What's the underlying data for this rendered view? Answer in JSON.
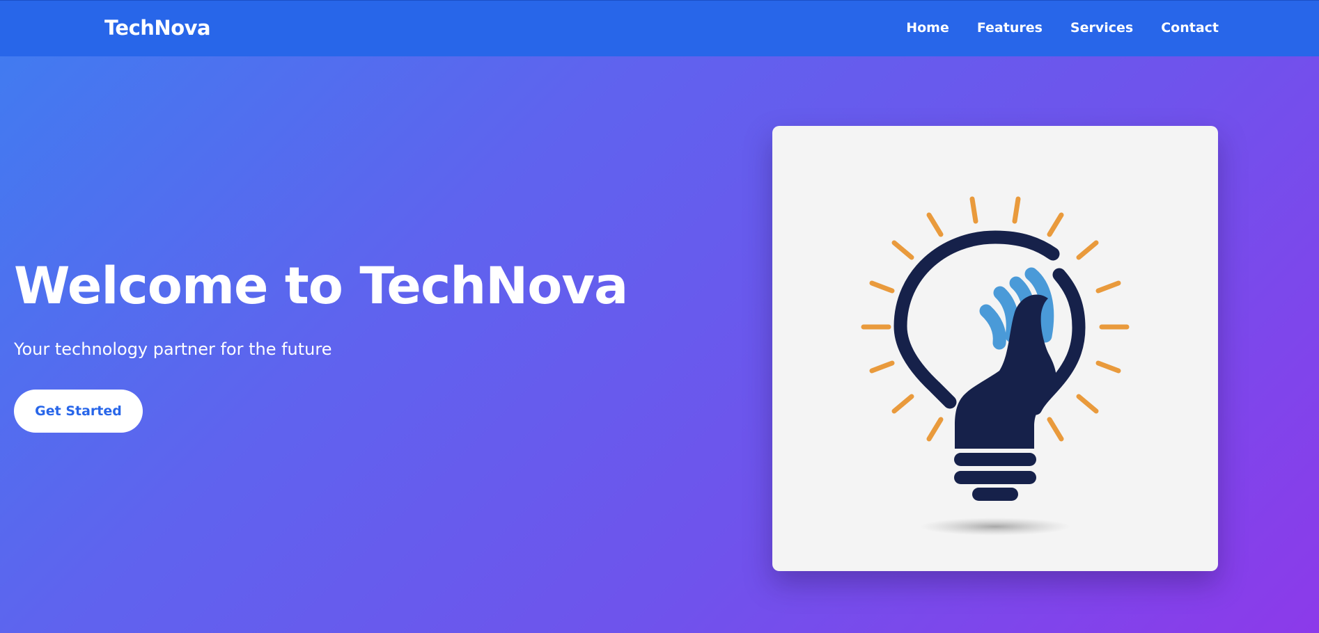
{
  "navbar": {
    "brand": "TechNova",
    "links": [
      "Home",
      "Features",
      "Services",
      "Contact"
    ]
  },
  "hero": {
    "title": "Welcome to TechNova",
    "subtitle": "Your technology partner for the future",
    "cta_label": "Get Started"
  },
  "illustration": {
    "icon": "lightbulb-hand-icon"
  },
  "colors": {
    "navbar_bg": "#2866e9",
    "accent": "#2866e9",
    "gradient_start": "#3f7df0",
    "gradient_end": "#8c3aea",
    "bulb_navy": "#16214a",
    "hand_blue": "#4a9ad8",
    "ray_orange": "#e99a3c"
  }
}
